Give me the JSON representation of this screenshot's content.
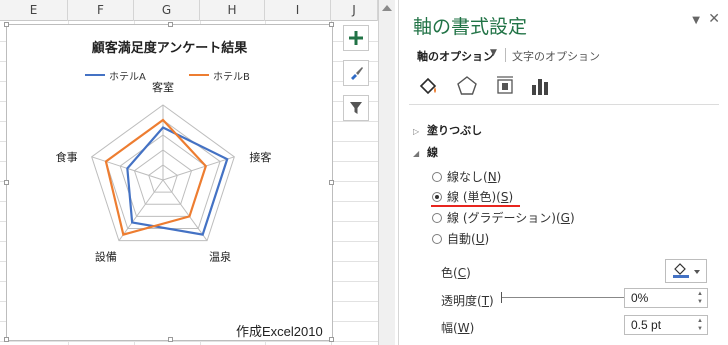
{
  "sheet": {
    "columns": [
      "E",
      "F",
      "G",
      "H",
      "I",
      "J"
    ]
  },
  "chart": {
    "title": "顧客満足度アンケート結果",
    "credit": "作成",
    "credit_en": "Excel2010",
    "colors": {
      "hotelA": "#4472c4",
      "hotelB": "#ed7d31",
      "grid": "#bdbdbd"
    }
  },
  "chart_data": {
    "type": "radar",
    "title": "顧客満足度アンケート結果",
    "categories": [
      "客室",
      "接客",
      "温泉",
      "設備",
      "食事"
    ],
    "series": [
      {
        "name": "ホテルA",
        "values": [
          3.5,
          4.5,
          4.5,
          3.5,
          2.5
        ]
      },
      {
        "name": "ホテルB",
        "values": [
          4,
          3,
          3,
          4.5,
          4
        ]
      }
    ],
    "ylim": [
      0,
      5
    ],
    "legend": "top"
  },
  "tools": [
    "plus-icon",
    "brush-icon",
    "filter-icon"
  ],
  "pane": {
    "title": "軸の書式設定",
    "tab_axis_options": "軸のオプション",
    "tab_text_options": "文字のオプション",
    "section_fill": "塗りつぶし",
    "section_line": "線",
    "radios": [
      {
        "label": "線なし(",
        "key": "N",
        "checked": false
      },
      {
        "label": "線 (単色)(",
        "key": "S",
        "checked": true
      },
      {
        "label": "線 (グラデーション)(",
        "key": "G",
        "checked": false
      },
      {
        "label": "自動(",
        "key": "U",
        "checked": false
      }
    ],
    "color_label": "色(",
    "color_key": "C",
    "transparency_label": "透明度(",
    "transparency_key": "T",
    "transparency_value": "0%",
    "width_label": "幅(",
    "width_key": "W",
    "width_value": "0.5 pt"
  }
}
